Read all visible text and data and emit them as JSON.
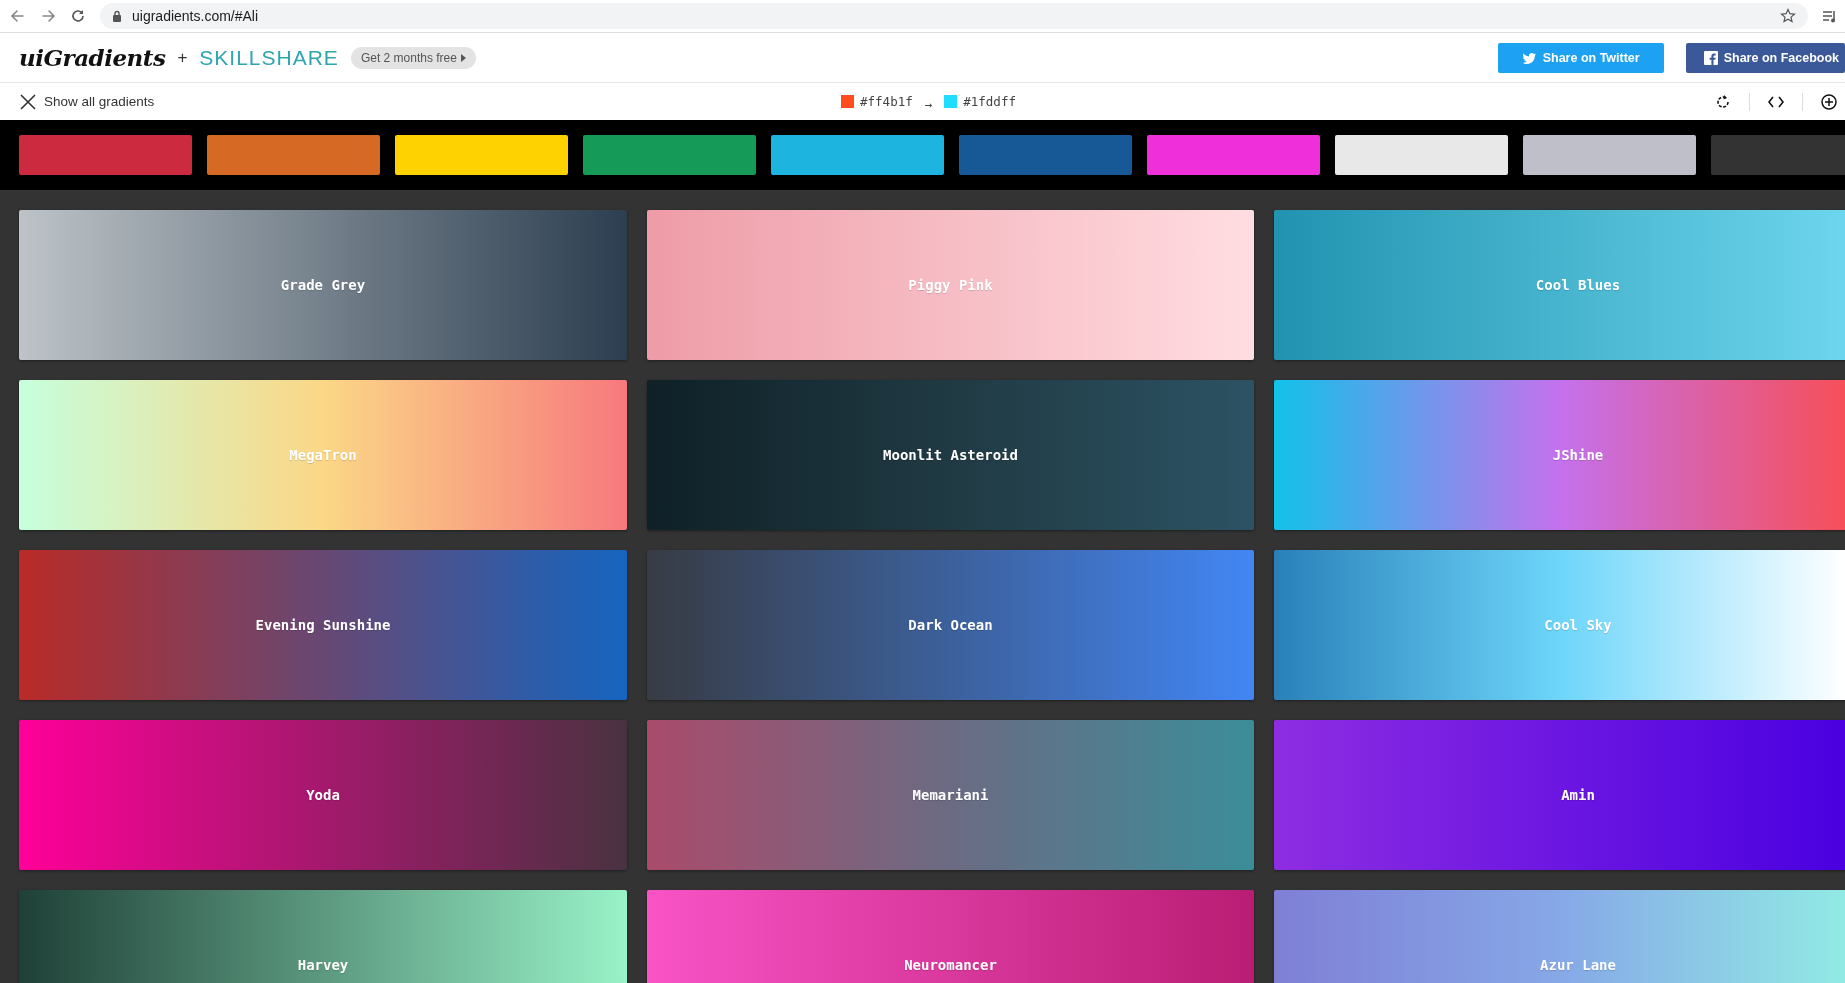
{
  "browser": {
    "url": "uigradients.com/#Ali"
  },
  "header": {
    "logo": "uiGradients",
    "plus": "+",
    "partner": "SKILLSHARE",
    "promo": "Get 2 months free",
    "buttons": [
      {
        "kind": "twitter",
        "label": "Share on Twitter"
      },
      {
        "kind": "facebook",
        "label": "Share on Facebook"
      }
    ]
  },
  "toolbar": {
    "show_all": "Show all gradients",
    "from": {
      "color": "#ff4b1f",
      "label": "#ff4b1f"
    },
    "arrow": "→",
    "to": {
      "color": "#1fddff",
      "label": "#1fddff"
    }
  },
  "palette": [
    {
      "color": "#cb2a3f"
    },
    {
      "color": "#d66a24"
    },
    {
      "color": "#fed201"
    },
    {
      "color": "#169a57"
    },
    {
      "color": "#1eb4e0"
    },
    {
      "color": "#175896"
    },
    {
      "color": "#ef30da"
    },
    {
      "color": "#e8e8e8"
    },
    {
      "color": "#bfbfc9"
    },
    {
      "color": "#333333"
    }
  ],
  "gradients": [
    {
      "name": "Grade Grey",
      "stops": [
        {
          "color": "#bdc3c7"
        },
        {
          "color": "#2c3e50"
        }
      ]
    },
    {
      "name": "Piggy Pink",
      "stops": [
        {
          "color": "#ee9ca7"
        },
        {
          "color": "#ffdde1"
        }
      ]
    },
    {
      "name": "Cool Blues",
      "stops": [
        {
          "color": "#2193b0"
        },
        {
          "color": "#6dd5ed"
        }
      ]
    },
    {
      "name": "MegaTron",
      "stops": [
        {
          "color": "#c6ffdd"
        },
        {
          "color": "#fbd786"
        },
        {
          "color": "#f7797d"
        }
      ]
    },
    {
      "name": "Moonlit Asteroid",
      "stops": [
        {
          "color": "#0f2027"
        },
        {
          "color": "#203a43"
        },
        {
          "color": "#2c5364"
        }
      ]
    },
    {
      "name": "JShine",
      "stops": [
        {
          "color": "#12c2e9"
        },
        {
          "color": "#c471ed"
        },
        {
          "color": "#f64f59"
        }
      ]
    },
    {
      "name": "Evening Sunshine",
      "stops": [
        {
          "color": "#b92b27"
        },
        {
          "color": "#1565c0"
        }
      ]
    },
    {
      "name": "Dark Ocean",
      "stops": [
        {
          "color": "#373b44"
        },
        {
          "color": "#4286f4"
        }
      ]
    },
    {
      "name": "Cool Sky",
      "stops": [
        {
          "color": "#2980b9"
        },
        {
          "color": "#6dd5fa"
        },
        {
          "color": "#ffffff"
        }
      ]
    },
    {
      "name": "Yoda",
      "stops": [
        {
          "color": "#ff0099"
        },
        {
          "color": "#493240"
        }
      ]
    },
    {
      "name": "Memariani",
      "stops": [
        {
          "color": "#aa4b6b"
        },
        {
          "color": "#6b6b83"
        },
        {
          "color": "#3b8d99"
        }
      ]
    },
    {
      "name": "Amin",
      "stops": [
        {
          "color": "#8e2de2"
        },
        {
          "color": "#4a00e0"
        }
      ]
    },
    {
      "name": "Harvey",
      "stops": [
        {
          "color": "#1f4037"
        },
        {
          "color": "#99f2c8"
        }
      ]
    },
    {
      "name": "Neuromancer",
      "stops": [
        {
          "color": "#f953c6"
        },
        {
          "color": "#b91d73"
        }
      ]
    },
    {
      "name": "Azur Lane",
      "stops": [
        {
          "color": "#7f7fd5"
        },
        {
          "color": "#86a8e7"
        },
        {
          "color": "#91eae4"
        }
      ]
    }
  ]
}
